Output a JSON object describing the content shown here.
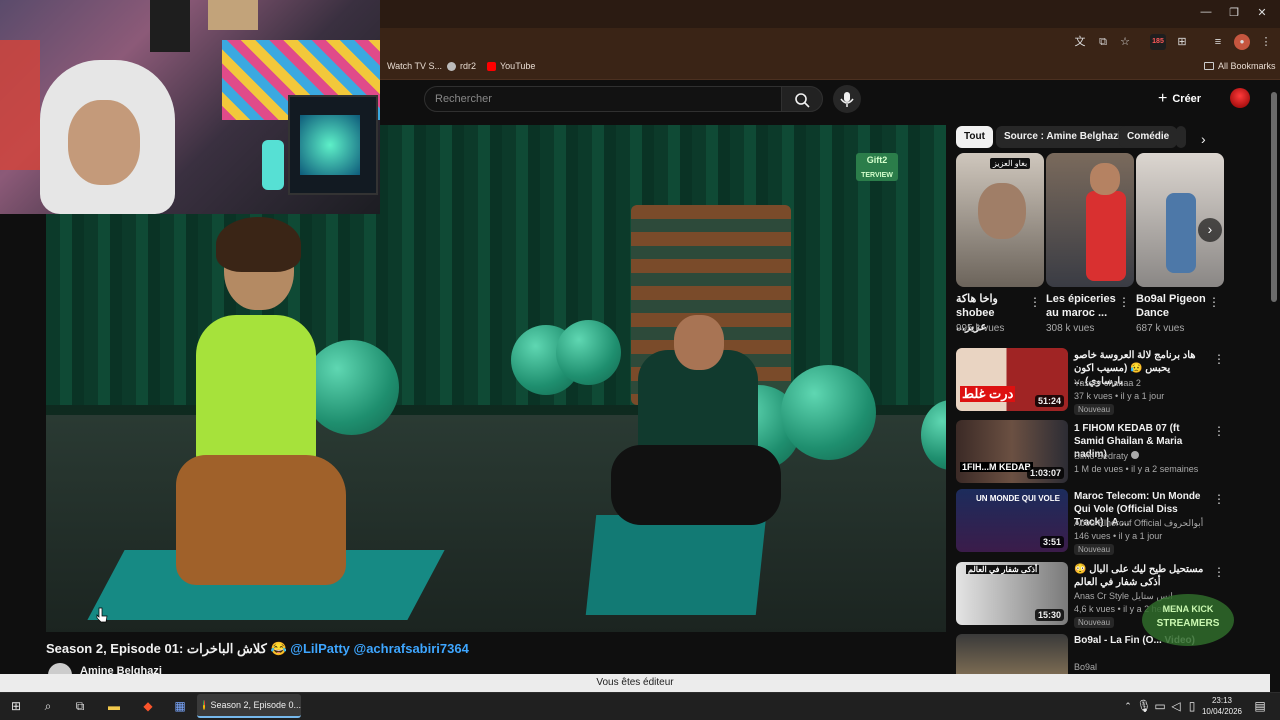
{
  "browser": {
    "bookmarks": [
      {
        "label": "Watch TV S...",
        "color": "#cccccc"
      },
      {
        "label": "rdr2",
        "color": "#bbbbbb"
      },
      {
        "label": "YouTube",
        "color": "#ff0000"
      }
    ],
    "all_bookmarks_label": "All Bookmarks",
    "extension_badge": "185"
  },
  "youtube": {
    "search_placeholder": "Rechercher",
    "create_label": "Créer"
  },
  "player": {
    "logo_text": "Gift2",
    "logo_sub": "TERVIEW"
  },
  "video": {
    "title_text": "Season 2, Episode 01: كلاش الباخرات 😂",
    "mentions": "@LilPatty @achrafsabiri7364",
    "channel_name": "Amine Belghazi"
  },
  "sidebar": {
    "chips": [
      "Tout",
      "Source : Amine Belghazi",
      "Comédie"
    ],
    "shorts": [
      {
        "title": "واخا هاكة shobee ...عزيز",
        "views": "995 k vues",
        "thumb_label": "بغاو العزيز"
      },
      {
        "title": "Les épiceries au maroc ...",
        "views": "308 k vues"
      },
      {
        "title": "Bo9al Pigeon Dance",
        "views": "687 k vues"
      }
    ],
    "recommendations": [
      {
        "title": "هاد برنامج لالة العروسة خاصو يحبس 😥 (مسيب اكون بارساوي) ...",
        "channel": "Yasser chanaa 2",
        "meta": "37 k vues • il y a 1 jour",
        "badge": "Nouveau",
        "duration": "51:24",
        "thumb_text": "درت غلط"
      },
      {
        "title": "1 FIHOM KEDAB 07 (ft Samid Ghailan & Maria nadim)",
        "channel": "Simo Sedraty",
        "meta": "1 M de vues • il y a 2 semaines",
        "badge": "",
        "duration": "1:03:07",
        "thumb_text": "1FIH...M KEDAB"
      },
      {
        "title": "Maroc Telecom: Un Monde Qui Vole (Official Diss Track) | A ...",
        "channel": "Abou-Elhorouf Official أبوالحروف",
        "meta": "146 vues • il y a 1 jour",
        "badge": "Nouveau",
        "duration": "3:51",
        "thumb_text": "UN MONDE QUI VOLE"
      },
      {
        "title": "مستحيل طيح ليك على البال 😳 أذكى شفار في العالم",
        "channel": "Anas Cr Style انس ستايل",
        "meta": "4,6 k vues • il y a 2 heures",
        "badge": "Nouveau",
        "duration": "15:30",
        "thumb_text": "أذكى شفار في العالم"
      },
      {
        "title": "Bo9al - La Fin (O... Video)",
        "channel": "Bo9al",
        "meta": "",
        "badge": "",
        "duration": "",
        "thumb_text": ""
      }
    ]
  },
  "status_bar": {
    "text": "Vous êtes éditeur"
  },
  "taskbar": {
    "active_task": "Season 2, Episode 0...",
    "time": "23:13",
    "date": "10/04/2026"
  },
  "overlay": {
    "logo_text": "MENA KICK STREAMERS"
  }
}
